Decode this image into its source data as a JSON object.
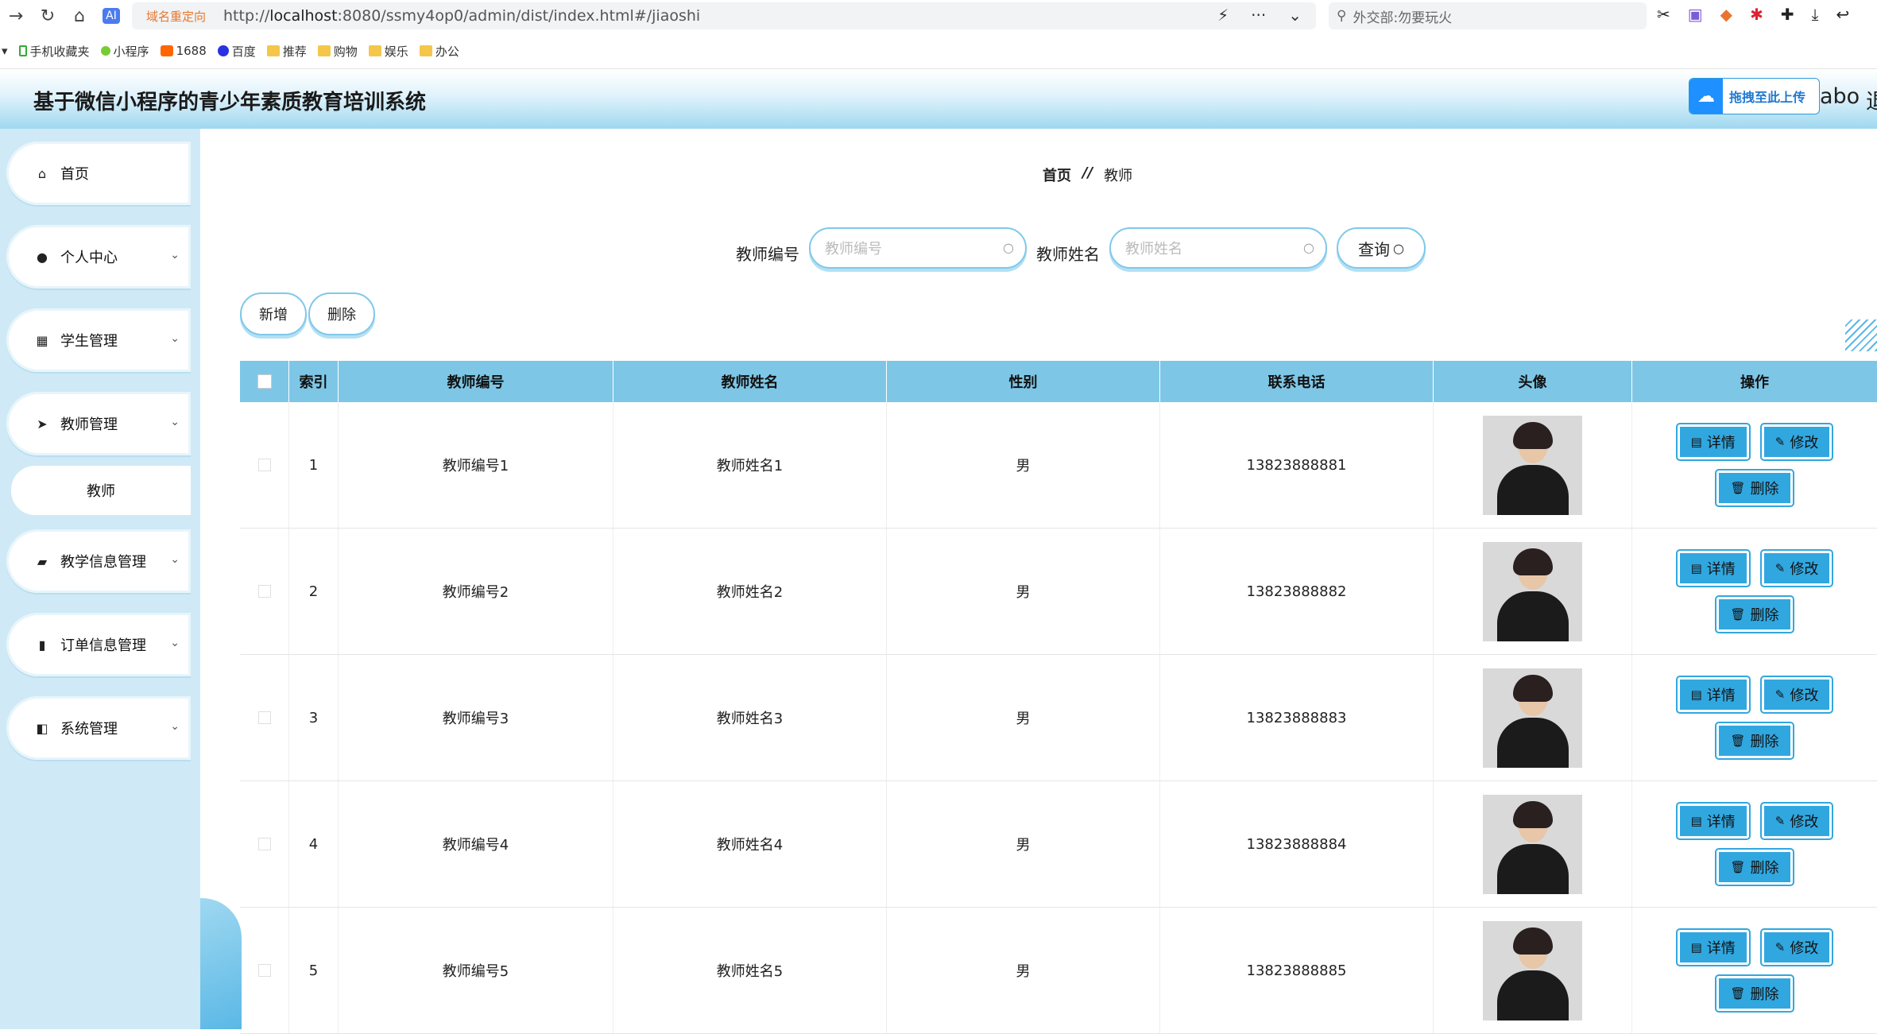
{
  "browser": {
    "redirect_tag": "域名重定向",
    "url_prefix": "http://",
    "url_host": "localhost",
    "url_rest": ":8080/ssmy4op0/admin/dist/index.html#/jiaoshi",
    "search_placeholder": "外交部:勿要玩火",
    "bookmarks": [
      {
        "label": "手机收藏夹",
        "icon": "phone-icon"
      },
      {
        "label": "小程序",
        "icon": "miniapp-icon"
      },
      {
        "label": "1688",
        "icon": "1688-icon"
      },
      {
        "label": "百度",
        "icon": "baidu-icon"
      },
      {
        "label": "推荐",
        "icon": "folder-icon"
      },
      {
        "label": "购物",
        "icon": "folder-icon"
      },
      {
        "label": "娱乐",
        "icon": "folder-icon"
      },
      {
        "label": "办公",
        "icon": "folder-icon"
      }
    ]
  },
  "header": {
    "title": "基于微信小程序的青少年素质教育培训系统",
    "upload_label": "拖拽至此上传",
    "user_partial": "abo",
    "extra_char": "退"
  },
  "sidebar": {
    "items": [
      {
        "label": "首页",
        "icon": "home-icon",
        "has_children": false
      },
      {
        "label": "个人中心",
        "icon": "user-icon",
        "has_children": true
      },
      {
        "label": "学生管理",
        "icon": "grid-icon",
        "has_children": true
      },
      {
        "label": "教师管理",
        "icon": "send-icon",
        "has_children": true
      },
      {
        "label": "教学信息管理",
        "icon": "briefcase-icon",
        "has_children": true
      },
      {
        "label": "订单信息管理",
        "icon": "chart-icon",
        "has_children": true
      },
      {
        "label": "系统管理",
        "icon": "settings-icon",
        "has_children": true
      }
    ],
    "active_subitem": "教师"
  },
  "breadcrumb": {
    "home": "首页",
    "separator": "//",
    "current": "教师"
  },
  "search": {
    "id_label": "教师编号",
    "id_placeholder": "教师编号",
    "name_label": "教师姓名",
    "name_placeholder": "教师姓名",
    "query_label": "查询"
  },
  "actions": {
    "add_label": "新增",
    "delete_label": "删除"
  },
  "table": {
    "columns": [
      "索引",
      "教师编号",
      "教师姓名",
      "性别",
      "联系电话",
      "头像",
      "操作"
    ],
    "op_labels": {
      "detail": "详情",
      "edit": "修改",
      "delete": "删除"
    },
    "rows": [
      {
        "index": "1",
        "teacher_id": "教师编号1",
        "teacher_name": "教师姓名1",
        "gender": "男",
        "phone": "13823888881"
      },
      {
        "index": "2",
        "teacher_id": "教师编号2",
        "teacher_name": "教师姓名2",
        "gender": "男",
        "phone": "13823888882"
      },
      {
        "index": "3",
        "teacher_id": "教师编号3",
        "teacher_name": "教师姓名3",
        "gender": "男",
        "phone": "13823888883"
      },
      {
        "index": "4",
        "teacher_id": "教师编号4",
        "teacher_name": "教师姓名4",
        "gender": "男",
        "phone": "13823888884"
      },
      {
        "index": "5",
        "teacher_id": "教师编号5",
        "teacher_name": "教师姓名5",
        "gender": "男",
        "phone": "13823888885"
      }
    ]
  },
  "colors": {
    "header_bar": "#7ec6e6",
    "sidebar_bg": "#cfe9f6",
    "op_button": "#31a7e0"
  }
}
